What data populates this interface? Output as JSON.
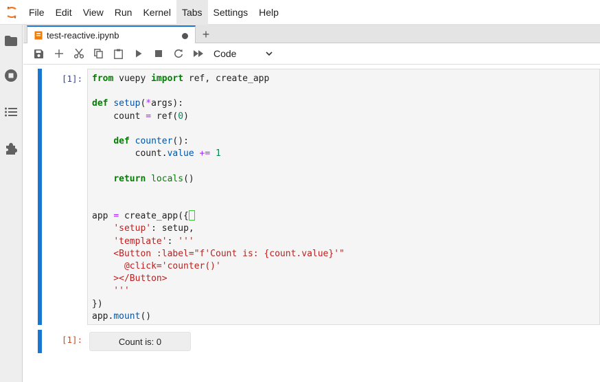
{
  "menu": [
    "File",
    "Edit",
    "View",
    "Run",
    "Kernel",
    "Tabs",
    "Settings",
    "Help"
  ],
  "tab": {
    "label": "test-reactive.ipynb"
  },
  "toolbar": {
    "cell_type": "Code"
  },
  "cell": {
    "prompt": "[1]:",
    "output_prompt": "[1]:",
    "code_lines": [
      "from vuepy import ref, create_app",
      "",
      "def setup(*args):",
      "    count = ref(0)",
      "",
      "    def counter():",
      "        count.value += 1",
      "",
      "    return locals()",
      "",
      "",
      "app = create_app({",
      "    'setup': setup,",
      "    'template': '''",
      "    <Button :label=\"f'Count is: {count.value}'\"",
      "      @click='counter()'",
      "    ></Button>",
      "    '''",
      "})",
      "app.mount()"
    ],
    "output_button": "Count is: 0"
  },
  "colors": {
    "accent": "#1976d2",
    "keyword": "#008000",
    "string": "#ba2121"
  },
  "icons": [
    "jupyter-logo",
    "folder-icon",
    "stop-icon",
    "list-icon",
    "puzzle-icon",
    "notebook-icon",
    "save-icon",
    "add-icon",
    "cut-icon",
    "copy-icon",
    "paste-icon",
    "run-icon",
    "stop-kernel-icon",
    "restart-icon",
    "fast-forward-icon",
    "chevron-down-icon"
  ]
}
